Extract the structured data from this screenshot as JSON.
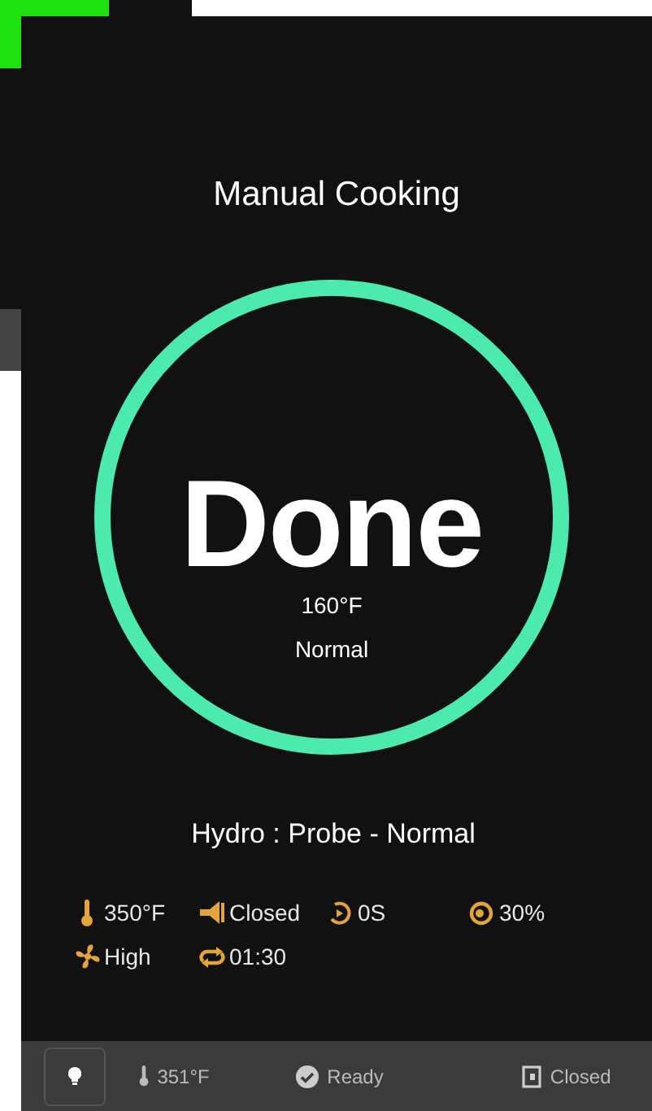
{
  "title": "Manual Cooking",
  "status": {
    "label": "Done",
    "temperature": "160°F",
    "mode": "Normal"
  },
  "probe": "Hydro : Probe - Normal",
  "settings": [
    {
      "kind": "temperature",
      "value": "350°F"
    },
    {
      "kind": "vent",
      "value": "Closed"
    },
    {
      "kind": "timer",
      "value": "0S"
    },
    {
      "kind": "humidity",
      "value": "30%"
    },
    {
      "kind": "fan",
      "value": "High"
    },
    {
      "kind": "cycle",
      "value": "01:30"
    }
  ],
  "status_bar": [
    {
      "kind": "light"
    },
    {
      "kind": "temperature",
      "text": "351°F"
    },
    {
      "kind": "ready",
      "text": "Ready"
    },
    {
      "kind": "door",
      "text": "Closed"
    }
  ]
}
